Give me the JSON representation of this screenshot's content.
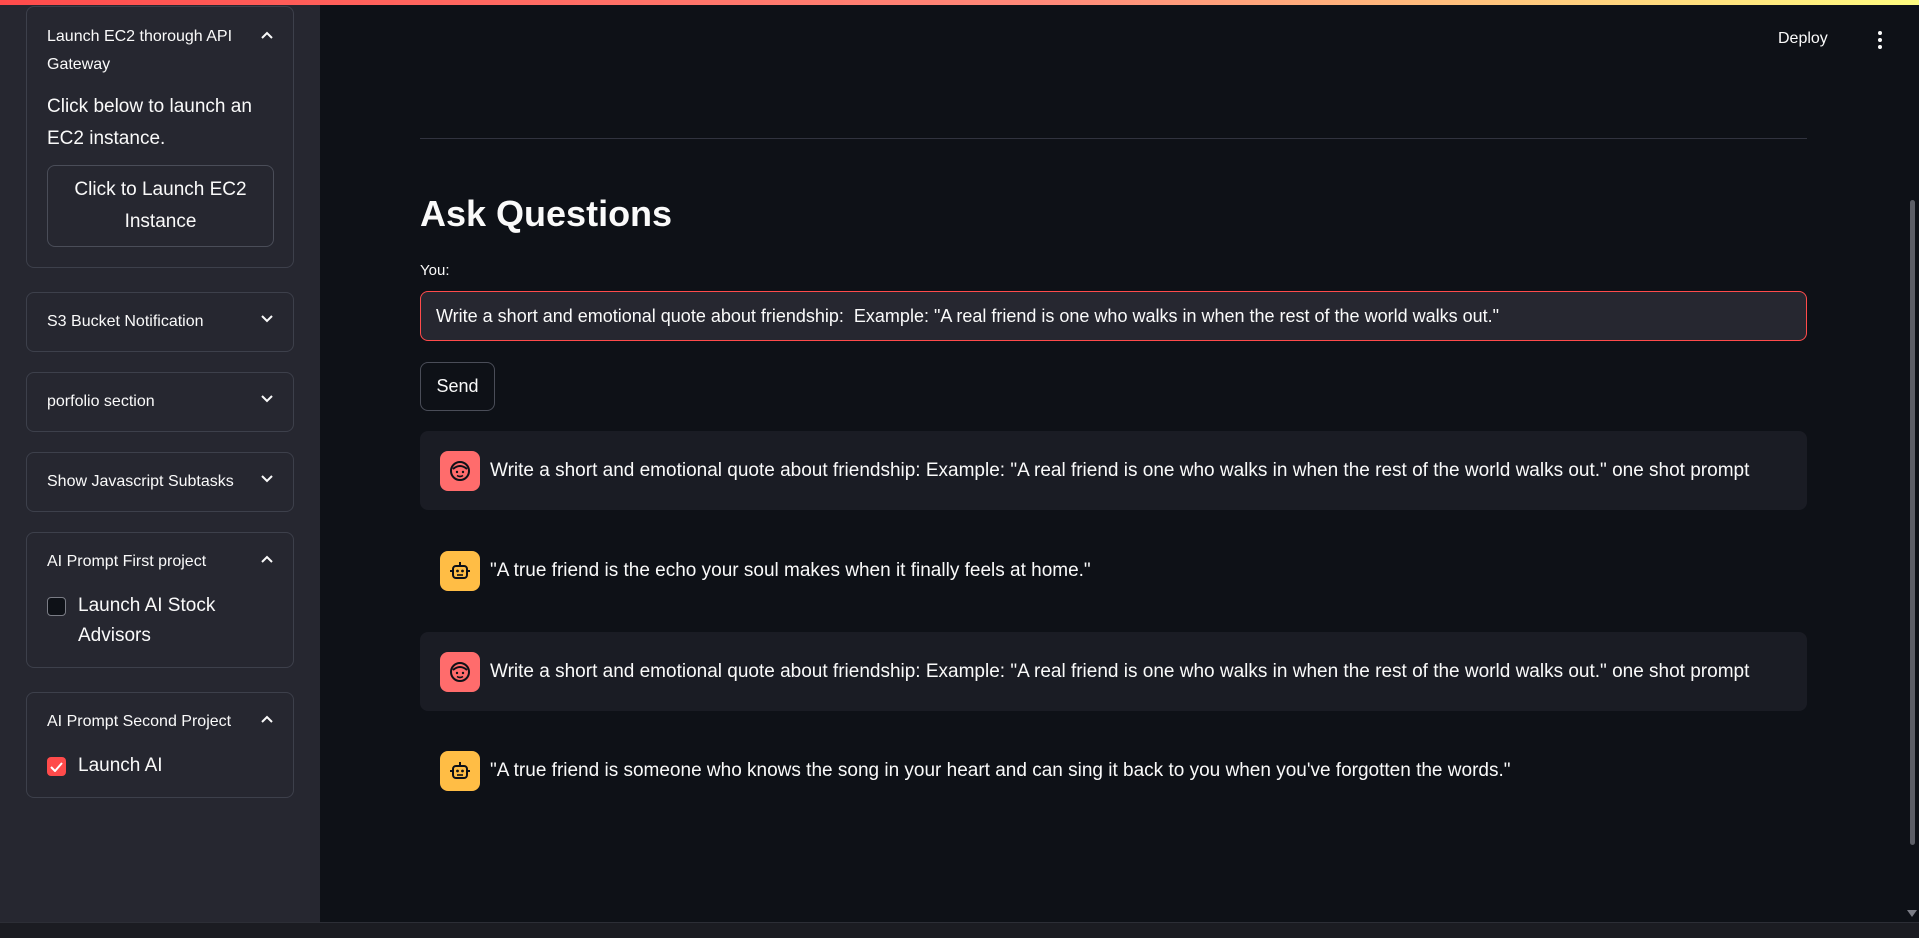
{
  "sidebar": {
    "expanders": [
      {
        "title": "Launch EC2 thorough API Gateway",
        "expanded": true,
        "body_text": "Click below to launch an EC2 instance.",
        "button_label": "Click to Launch EC2 Instance"
      },
      {
        "title": "S3 Bucket Notification",
        "expanded": false
      },
      {
        "title": "porfolio section",
        "expanded": false
      },
      {
        "title": "Show Javascript Subtasks",
        "expanded": false
      },
      {
        "title": "AI Prompt First project",
        "expanded": true,
        "checkbox_label": "Launch AI Stock Advisors",
        "checked": false
      },
      {
        "title": "AI Prompt Second Project",
        "expanded": true,
        "checkbox_label": "Launch AI",
        "checked": true
      }
    ]
  },
  "header": {
    "deploy_label": "Deploy",
    "menu_icon": "kebab-menu-icon"
  },
  "main": {
    "title": "Ask Questions",
    "input_label": "You:",
    "input_value": "Write a short and emotional quote about friendship:  Example: \"A real friend is one who walks in when the rest of the world walks out.\"",
    "send_label": "Send",
    "messages": [
      {
        "role": "user",
        "icon": "user-face-icon",
        "text": "Write a short and emotional quote about friendship: Example: \"A real friend is one who walks in when the rest of the world walks out.\" one shot prompt"
      },
      {
        "role": "assistant",
        "icon": "robot-icon",
        "text": "\"A true friend is the echo your soul makes when it finally feels at home.\""
      },
      {
        "role": "user",
        "icon": "user-face-icon",
        "text": "Write a short and emotional quote about friendship: Example: \"A real friend is one who walks in when the rest of the world walks out.\" one shot prompt"
      },
      {
        "role": "assistant",
        "icon": "robot-icon",
        "text": "\"A true friend is someone who knows the song in your heart and can sing it back to you when you've forgotten the words.\""
      }
    ]
  },
  "colors": {
    "background": "#0e1117",
    "sidebar": "#262730",
    "accent": "#ff4b4b",
    "user_avatar": "#ff6c6c",
    "bot_avatar": "#ffbd45"
  }
}
